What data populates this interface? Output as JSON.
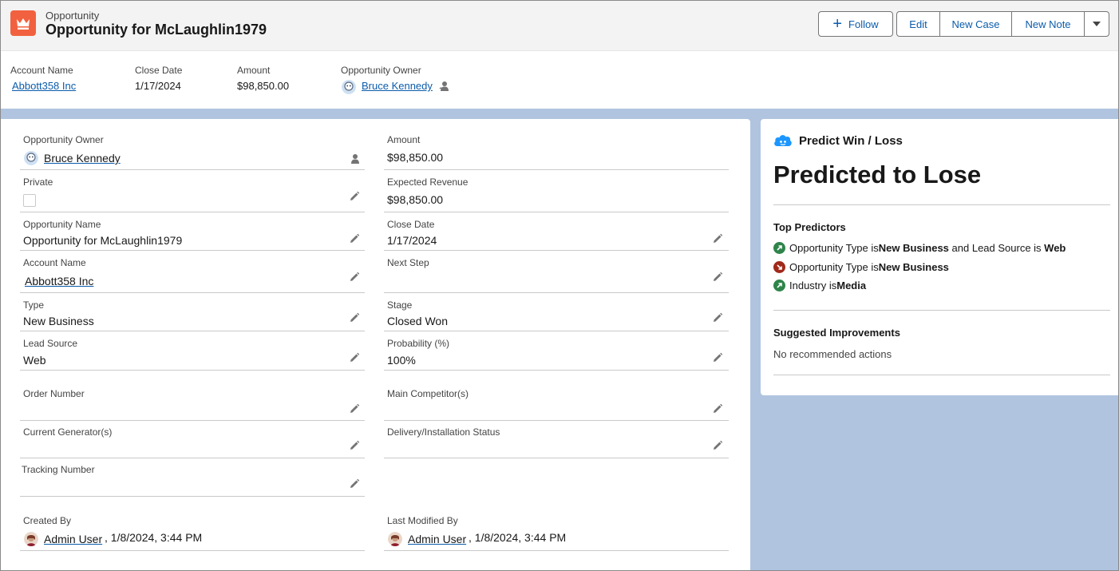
{
  "header": {
    "object_type": "Opportunity",
    "record_title": "Opportunity for McLaughlin1979",
    "follow_label": "Follow",
    "edit_label": "Edit",
    "new_case_label": "New Case",
    "new_note_label": "New Note"
  },
  "highlights": {
    "account_name_label": "Account Name",
    "account_name": "Abbott358 Inc",
    "close_date_label": "Close Date",
    "close_date": "1/17/2024",
    "amount_label": "Amount",
    "amount": "$98,850.00",
    "owner_label": "Opportunity Owner",
    "owner": "Bruce Kennedy"
  },
  "details": {
    "owner_label": "Opportunity Owner",
    "owner": "Bruce Kennedy",
    "amount_label": "Amount",
    "amount": "$98,850.00",
    "private_label": "Private",
    "expected_revenue_label": "Expected Revenue",
    "expected_revenue": "$98,850.00",
    "opp_name_label": "Opportunity Name",
    "opp_name": "Opportunity for McLaughlin1979",
    "close_date_label": "Close Date",
    "close_date": "1/17/2024",
    "account_name_label": "Account Name",
    "account_name": "Abbott358 Inc",
    "next_step_label": "Next Step",
    "type_label": "Type",
    "type": "New Business",
    "stage_label": "Stage",
    "stage": "Closed Won",
    "lead_source_label": "Lead Source",
    "lead_source": "Web",
    "probability_label": "Probability (%)",
    "probability": "100%",
    "order_number_label": "Order Number",
    "main_competitors_label": "Main Competitor(s)",
    "current_generators_label": "Current Generator(s)",
    "delivery_status_label": "Delivery/Installation Status",
    "tracking_number_label": "Tracking Number",
    "created_by_label": "Created By",
    "created_by": "Admin User",
    "created_date": ", 1/8/2024, 3:44 PM",
    "last_modified_label": "Last Modified By",
    "last_modified_by": "Admin User",
    "last_modified_date": ", 1/8/2024, 3:44 PM"
  },
  "prediction": {
    "panel_title": "Predict Win / Loss",
    "result": "Predicted to Lose",
    "top_predictors_label": "Top Predictors",
    "predictors": [
      {
        "direction": "up",
        "text1": "Opportunity Type is ",
        "bold1": "New Business",
        "text2": " and Lead Source is ",
        "bold2": "Web"
      },
      {
        "direction": "down",
        "text1": "Opportunity Type is ",
        "bold1": "New Business",
        "text2": "",
        "bold2": ""
      },
      {
        "direction": "up",
        "text1": "Industry is ",
        "bold1": "Media",
        "text2": "",
        "bold2": ""
      }
    ],
    "suggested_label": "Suggested Improvements",
    "suggested_text": "No recommended actions"
  },
  "colors": {
    "brand_icon": "#f2613f",
    "link": "#0b5cab",
    "positive": "#2e844a",
    "negative": "#ba0517",
    "page_bg": "#b0c4df"
  },
  "icons": [
    "crown-icon",
    "plus-icon",
    "chevron-down-icon",
    "pencil-icon",
    "change-owner-icon",
    "einstein-cloud-icon",
    "arrow-up-right-icon",
    "arrow-down-right-icon",
    "user-avatar-icon"
  ]
}
